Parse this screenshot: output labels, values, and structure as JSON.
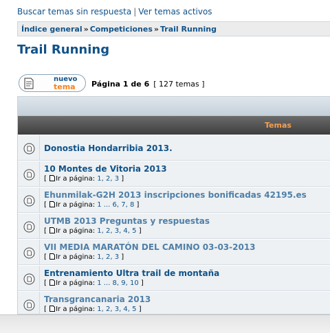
{
  "toplinks": {
    "unanswered": "Buscar temas sin respuesta",
    "separator": "|",
    "active": "Ver temas activos"
  },
  "breadcrumb": {
    "items": [
      "Índice general",
      "Competiciones",
      "Trail Running"
    ],
    "separator": "»"
  },
  "page_title": "Trail Running",
  "new_topic": {
    "line1": "nuevo",
    "line2": "tema"
  },
  "pagination": {
    "label": "Página 1 de 6",
    "count": "[ 127 temas ]"
  },
  "table": {
    "header": "Temas"
  },
  "topics": [
    {
      "title": "Donostia Hondarribia 2013.",
      "pages": ""
    },
    {
      "title": "10 Montes de Vitoria 2013",
      "pages_prefix": "[",
      "pages_label": "Ir a página:",
      "pages": "1, 2, 3",
      "pages_suffix": "]"
    },
    {
      "title": "Ehunmilak-G2H 2013 inscripciones bonificadas 42195.es",
      "pages_prefix": "[",
      "pages_label": "Ir a página:",
      "pages": "1 ... 6, 7, 8",
      "pages_suffix": "]"
    },
    {
      "title": "UTMB 2013 Preguntas y respuestas",
      "pages_prefix": "[",
      "pages_label": "Ir a página:",
      "pages": "1, 2, 3, 4, 5",
      "pages_suffix": "]"
    },
    {
      "title": "VII MEDIA MARATÓN DEL CAMINO 03-03-2013",
      "pages_prefix": "[",
      "pages_label": "Ir a página:",
      "pages": "1, 2, 3",
      "pages_suffix": "]"
    },
    {
      "title": "Entrenamiento Ultra trail de montaña",
      "pages_prefix": "[",
      "pages_label": "Ir a página:",
      "pages": "1 ... 8, 9, 10",
      "pages_suffix": "]"
    },
    {
      "title": "Transgrancanaria 2013",
      "pages_prefix": "[",
      "pages_label": "Ir a página:",
      "pages": "1, 2, 3, 4, 5",
      "pages_suffix": "]"
    }
  ],
  "icons": {
    "topic": "topic-read-icon",
    "new_topic": "new-topic-doc-icon",
    "page": "page-doc-icon"
  },
  "colors": {
    "link": "#105289",
    "accent": "#f58220",
    "header_text": "#f5a04e"
  }
}
